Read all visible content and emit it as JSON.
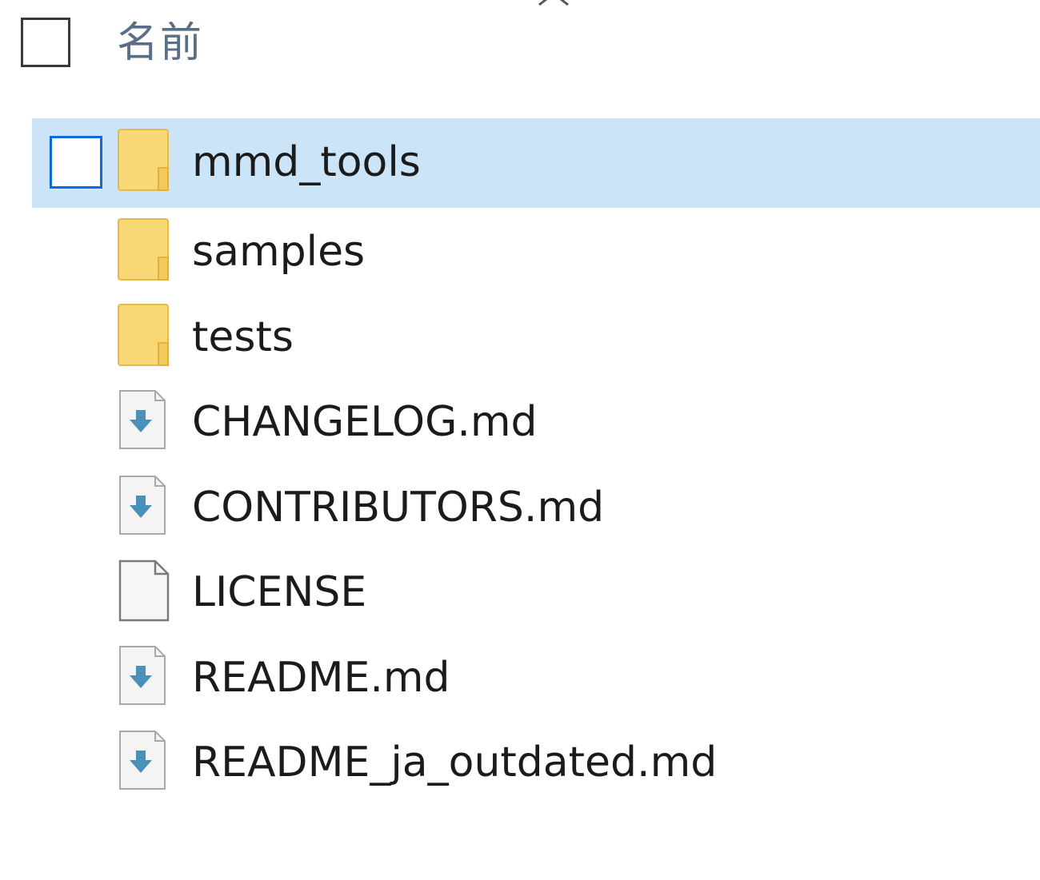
{
  "header": {
    "name_label": "名前"
  },
  "items": [
    {
      "name": "mmd_tools",
      "icon": "folder-icon",
      "selected": true
    },
    {
      "name": "samples",
      "icon": "folder-icon",
      "selected": false
    },
    {
      "name": "tests",
      "icon": "folder-icon",
      "selected": false
    },
    {
      "name": "CHANGELOG.md",
      "icon": "markdown-file-icon",
      "selected": false
    },
    {
      "name": "CONTRIBUTORS.md",
      "icon": "markdown-file-icon",
      "selected": false
    },
    {
      "name": "LICENSE",
      "icon": "generic-file-icon",
      "selected": false
    },
    {
      "name": "README.md",
      "icon": "markdown-file-icon",
      "selected": false
    },
    {
      "name": "README_ja_outdated.md",
      "icon": "markdown-file-icon",
      "selected": false
    }
  ],
  "colors": {
    "selection_bg": "#cce4f7",
    "checkbox_accent": "#0a6cd6",
    "folder_yellow": "#f8d775",
    "md_arrow": "#4a90b8"
  }
}
